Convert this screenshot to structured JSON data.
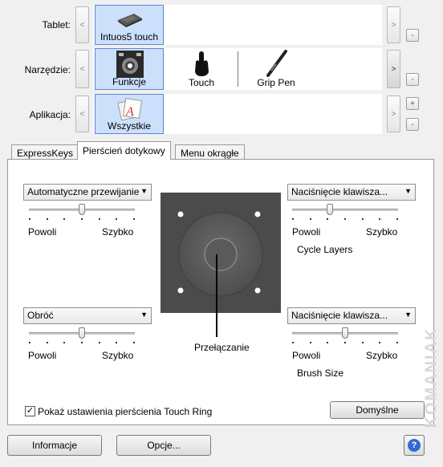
{
  "tablet": {
    "label": "Tablet:",
    "items": [
      {
        "label": "Intuos5 touch"
      }
    ]
  },
  "tool": {
    "label": "Narzędzie:",
    "items": [
      {
        "label": "Funkcje"
      },
      {
        "label": "Touch"
      },
      {
        "label": "Grip Pen"
      }
    ]
  },
  "application": {
    "label": "Aplikacja:",
    "items": [
      {
        "label": "Wszystkie"
      }
    ]
  },
  "buttons": {
    "prev": "<",
    "next": ">",
    "add": "+",
    "remove": "-"
  },
  "tabs": [
    {
      "label": "ExpressKeys"
    },
    {
      "label": "Pierścień dotykowy"
    },
    {
      "label": "Menu okrągłe"
    }
  ],
  "panel": {
    "top_left": {
      "dropdown": "Automatyczne przewijanie",
      "slow": "Powoli",
      "fast": "Szybko",
      "slider_value": 0.5
    },
    "bottom_left": {
      "dropdown": "Obróć",
      "slow": "Powoli",
      "fast": "Szybko",
      "slider_value": 0.5
    },
    "top_right": {
      "dropdown": "Naciśnięcie klawisza...",
      "slow": "Powoli",
      "fast": "Szybko",
      "slider_value": 0.35,
      "caption": "Cycle Layers"
    },
    "bottom_right": {
      "dropdown": "Naciśnięcie klawisza...",
      "slow": "Powoli",
      "fast": "Szybko",
      "slider_value": 0.5,
      "caption": "Brush Size"
    },
    "center_caption": "Przełączanie",
    "checkbox_label": "Pokaż ustawienia pierścienia Touch Ring",
    "checkbox_checked": true,
    "default_button": "Domyślne"
  },
  "footer": {
    "info_button": "Informacje",
    "options_button": "Opcje...",
    "help_icon": "?"
  },
  "watermark": "KOMANIAK"
}
